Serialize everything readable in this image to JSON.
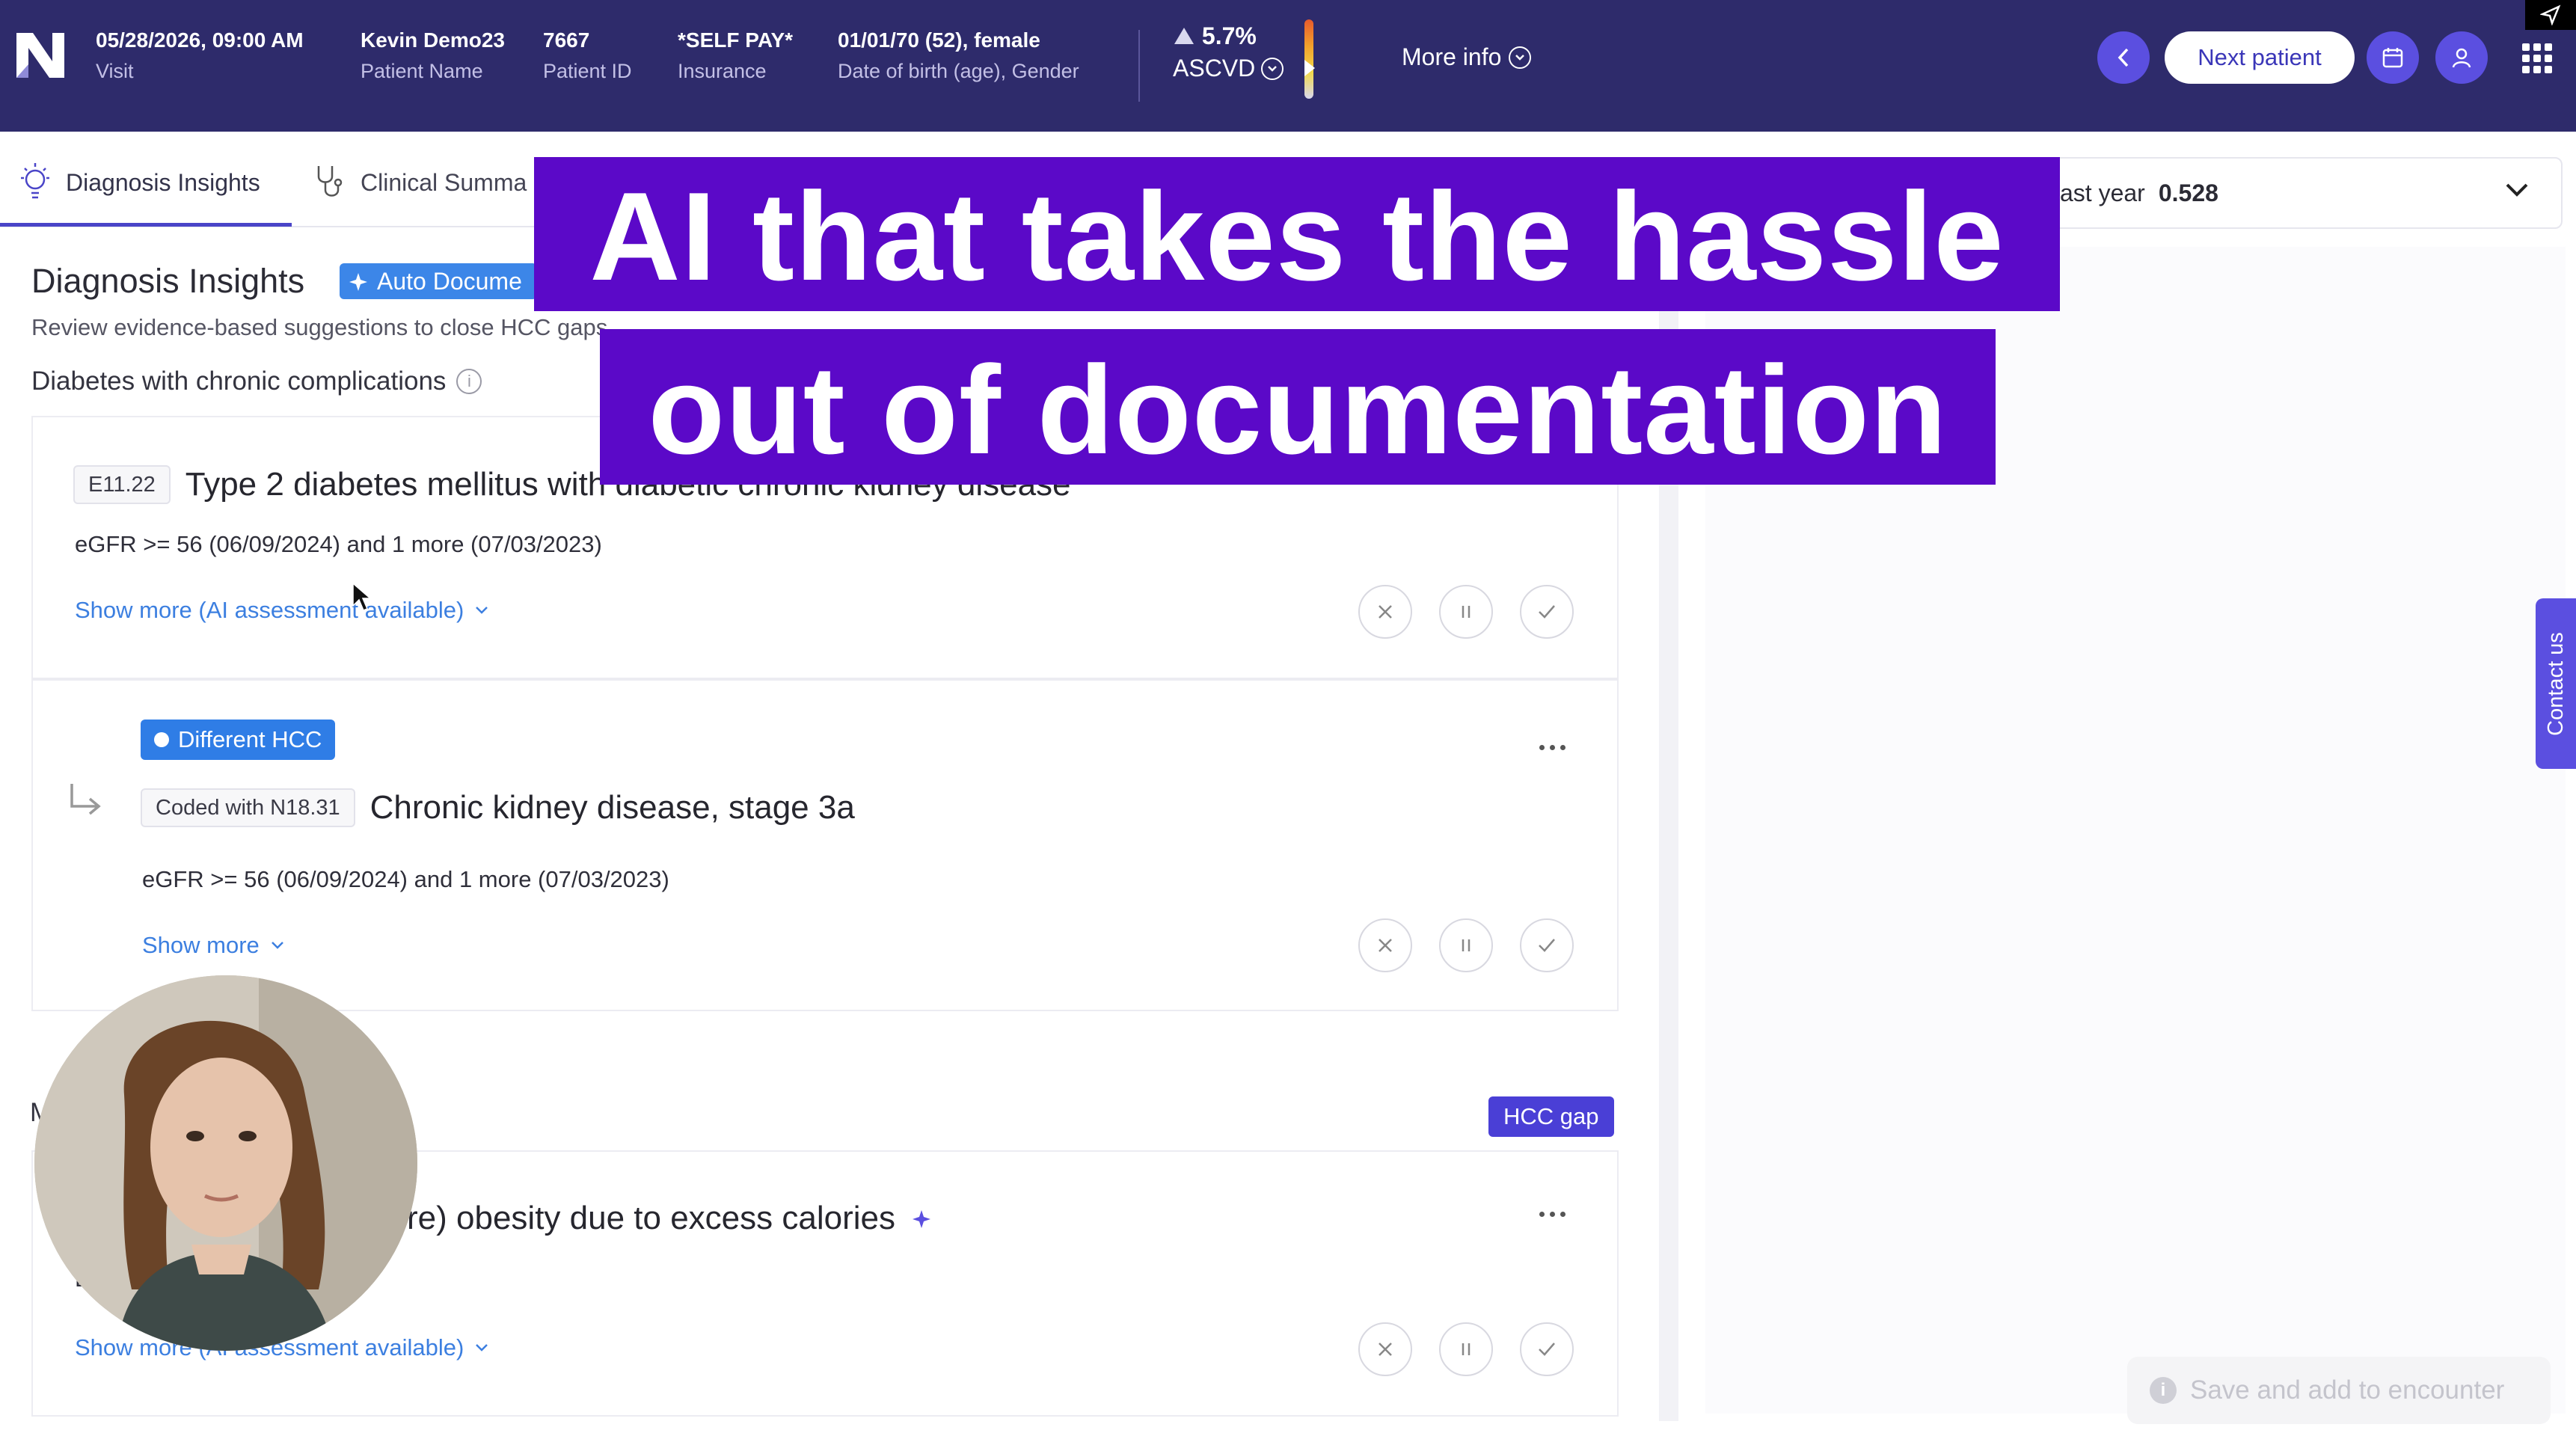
{
  "header": {
    "visit": {
      "value": "05/28/2026, 09:00 AM",
      "label": "Visit"
    },
    "patient_name": {
      "value": "Kevin Demo23",
      "label": "Patient Name"
    },
    "patient_id": {
      "value": "7667",
      "label": "Patient ID"
    },
    "insurance": {
      "value": "*SELF PAY*",
      "label": "Insurance"
    },
    "dob": {
      "value": "01/01/70 (52), female",
      "label": "Date of birth (age), Gender"
    },
    "ascvd": {
      "value": "5.7%",
      "label": "ASCVD"
    },
    "more_info": "More info",
    "next_patient": "Next patient"
  },
  "tabs": [
    {
      "label": "Diagnosis Insights",
      "icon": "lightbulb-icon"
    },
    {
      "label": "Clinical Summa",
      "icon": "stethoscope-icon"
    }
  ],
  "right_panel": {
    "select_label": "ast year",
    "select_value": "0.528",
    "contact_us": "Contact us",
    "save_button": "Save and add to encounter"
  },
  "main": {
    "title": "Diagnosis Insights",
    "auto_badge": "Auto Docume",
    "subtitle": "Review evidence-based suggestions to close HCC gaps",
    "section_title": "Diabetes with chronic complications",
    "cards": [
      {
        "code": "E11.22",
        "title": "Type 2 diabetes mellitus with diabetic chronic kidney disease",
        "evidence": "eGFR >= 56 (06/09/2024) and 1 more (07/03/2023)",
        "show_more": "Show more (AI assessment available)"
      },
      {
        "badge": "Different HCC",
        "code": "Coded with N18.31",
        "title": "Chronic kidney disease, stage 3a",
        "evidence": "eGFR >= 56 (06/09/2024) and 1 more (07/03/2023)",
        "show_more": "Show more"
      },
      {
        "section_partial": "M",
        "hcc_badge": "HCC gap",
        "title": "re) obesity due to excess calories",
        "evidence_partial": "E",
        "show_more": "Show more (AI assessment available)"
      }
    ]
  },
  "overlay": {
    "line1": "AI that takes the hassle",
    "line2": "out of documentation"
  },
  "colors": {
    "header_bg": "#2e2b6b",
    "accent": "#5b4fe0",
    "overlay_bg": "#5b09c8",
    "link": "#3c7fe0"
  }
}
